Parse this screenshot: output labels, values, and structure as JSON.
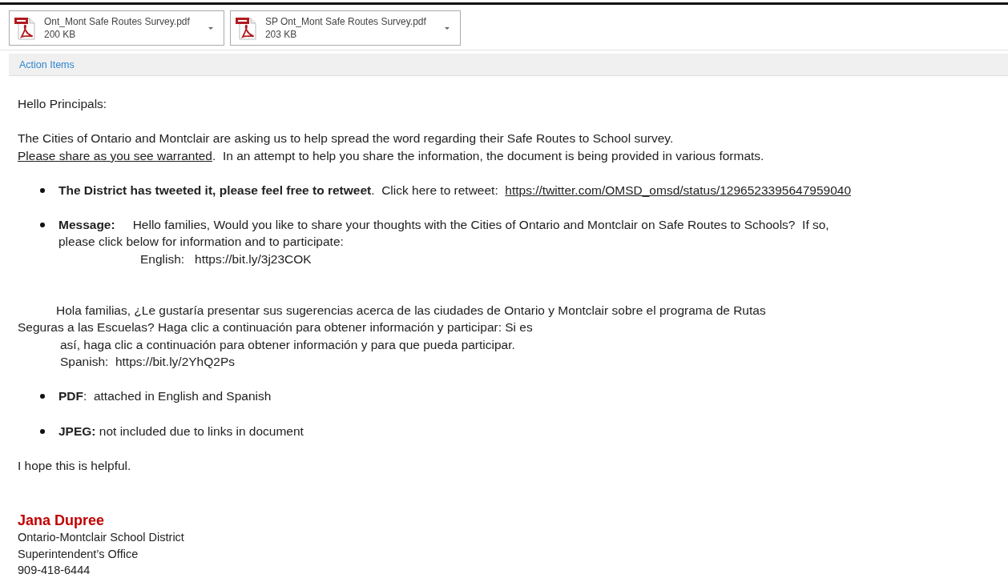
{
  "attachments": [
    {
      "name": "Ont_Mont Safe Routes Survey.pdf",
      "size": "200 KB"
    },
    {
      "name": "SP Ont_Mont Safe Routes Survey.pdf",
      "size": "203 KB"
    }
  ],
  "action_items": "Action Items",
  "greeting": "Hello Principals:",
  "intro": {
    "line_1": "The Cities of Ontario and Montclair are asking us to help spread the word regarding their Safe Routes to School survey.",
    "underlined": "Please share as you see warranted",
    "line_2": ".  In an attempt to help you share the information, the document is being provided in various formats."
  },
  "bullets": [
    {
      "kind": "tweet",
      "lead": "The District has tweeted it, please feel free to retweet",
      "text": ".  Click here to retweet: ",
      "link": "https://twitter.com/OMSD_omsd/status/1296523395647959040"
    },
    {
      "kind": "message",
      "lead": "Message:",
      "lines": [
        "Hello families, Would you like to share your thoughts with the Cities of Ontario and Montclair on Safe Routes to Schools?  If so,",
        "please click below for information and to participate:"
      ],
      "english": "English:   https://bit.ly/3j23COK",
      "spanish_lines": [
        "Hola familias, ¿Le gustaría presentar sus sugerencias acerca de las ciudades de Ontario y Montclair sobre el programa de Rutas",
        "Seguras a las Escuelas? Haga clic a continuación para obtener información y participar: Si es",
        "así, haga clic a continuación para obtener información y para que pueda participar.",
        "Spanish:  https://bit.ly/2YhQ2Ps"
      ]
    },
    {
      "kind": "note",
      "lead": "PDF",
      "text": ":  attached in English and Spanish"
    },
    {
      "kind": "note",
      "lead": "JPEG:",
      "text": " not included due to links in document"
    }
  ],
  "closing": "I hope this is helpful.",
  "signature": {
    "name": "Jana Dupree",
    "lines": [
      "Ontario-Montclair School District",
      "Superintendent’s Office",
      "909-418-6444"
    ]
  }
}
